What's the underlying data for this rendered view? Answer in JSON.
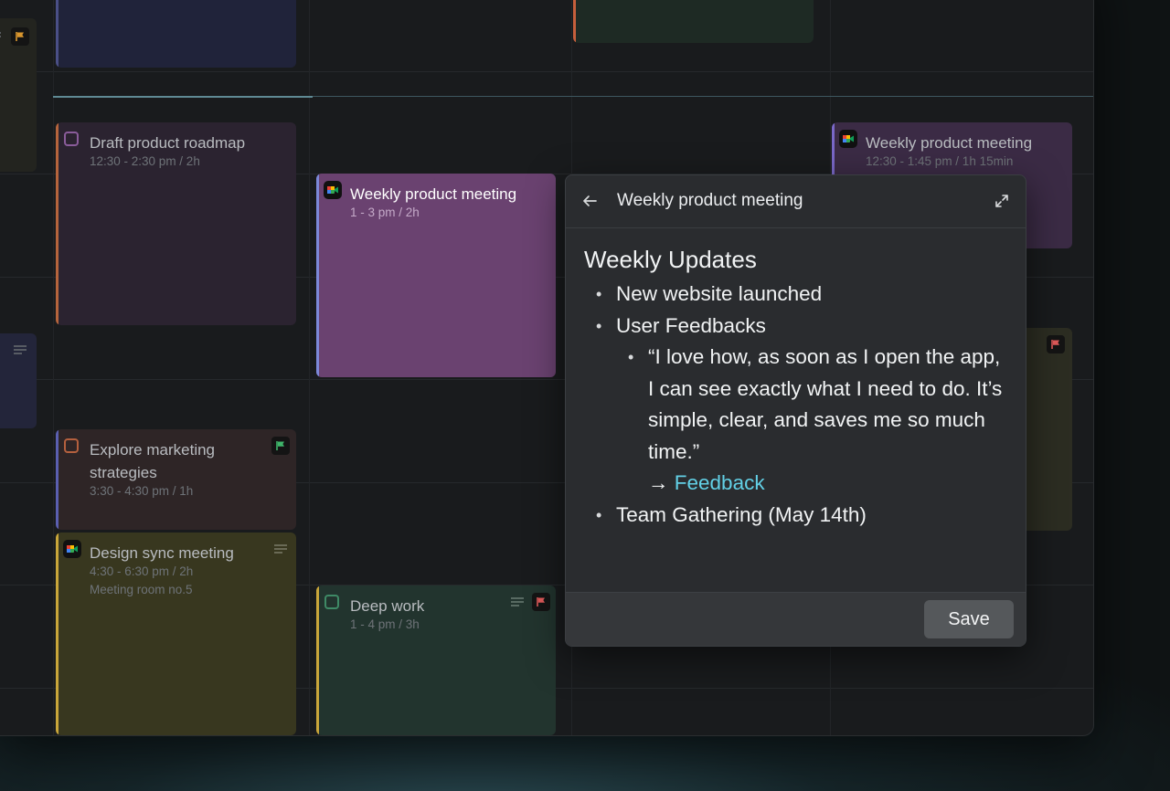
{
  "events": {
    "draft_roadmap": {
      "title": "Draft product roadmap",
      "time": "12:30 - 2:30 pm / 2h"
    },
    "weekly_meeting_selected": {
      "title": "Weekly product meeting",
      "time": "1 - 3 pm / 2h"
    },
    "weekly_meeting_right": {
      "title": "Weekly product meeting",
      "time": "12:30 - 1:45 pm / 1h 15min"
    },
    "explore_marketing": {
      "title_line1": "Explore marketing",
      "title_line2": "strategies",
      "time": "3:30 - 4:30 pm / 1h"
    },
    "design_sync": {
      "title": "Design sync meeting",
      "time": "4:30 - 6:30 pm / 2h",
      "location": "Meeting room no.5"
    },
    "deep_work": {
      "title": "Deep work",
      "time": "1 - 4 pm / 3h"
    }
  },
  "popover": {
    "title": "Weekly product meeting",
    "heading": "Weekly Updates",
    "bullets": {
      "b1": "New website launched",
      "b2": "User Feedbacks",
      "quote": "“I love how, as soon as I open the app, I can see exactly what I need to do. It’s simple, clear, and saves me so much time.”",
      "arrow": "→ ",
      "link": "Feedback",
      "b3": "Team Gathering (May 14th)"
    },
    "save_label": "Save"
  },
  "colors": {
    "accent_link": "#62d0e6",
    "selected_event": "#6a4270",
    "flag_green": "#3fb56a",
    "flag_red": "#e05a5a",
    "flag_orange": "#d9962e"
  },
  "icons": [
    "back-arrow-icon",
    "expand-icon",
    "google-meet-icon",
    "flag-icon",
    "description-lines-icon",
    "checkbox-icon"
  ]
}
